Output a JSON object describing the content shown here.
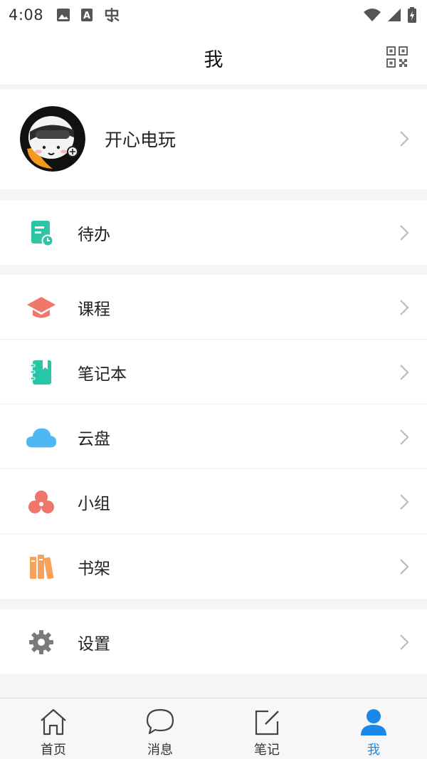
{
  "status_bar": {
    "time": "4:08",
    "left_icons": [
      "image-icon",
      "font-a-icon",
      "bug-icon"
    ],
    "right_icons": [
      "wifi-icon",
      "signal-icon",
      "battery-charging-icon"
    ]
  },
  "header": {
    "title": "我",
    "action_icon": "qr-code-icon"
  },
  "profile": {
    "name": "开心电玩",
    "avatar": "avatar-image"
  },
  "menu": {
    "todo": {
      "label": "待办",
      "icon": "todo-icon",
      "color": "#2ec4a6"
    },
    "course": {
      "label": "课程",
      "icon": "graduation-cap-icon",
      "color": "#f0776c"
    },
    "notebook": {
      "label": "笔记本",
      "icon": "notebook-icon",
      "color": "#26c6a8"
    },
    "cloud": {
      "label": "云盘",
      "icon": "cloud-icon",
      "color": "#4fb8f4"
    },
    "group": {
      "label": "小组",
      "icon": "group-icon",
      "color": "#f0756b"
    },
    "bookshelf": {
      "label": "书架",
      "icon": "bookshelf-icon",
      "color": "#f7a25a"
    },
    "settings": {
      "label": "设置",
      "icon": "gear-icon",
      "color": "#7a7a7a"
    }
  },
  "tabbar": {
    "home": {
      "label": "首页",
      "icon": "home-icon"
    },
    "messages": {
      "label": "消息",
      "icon": "chat-bubble-icon"
    },
    "notes": {
      "label": "笔记",
      "icon": "edit-note-icon"
    },
    "me": {
      "label": "我",
      "icon": "person-icon",
      "active": true
    },
    "active_color": "#1a88e6"
  }
}
